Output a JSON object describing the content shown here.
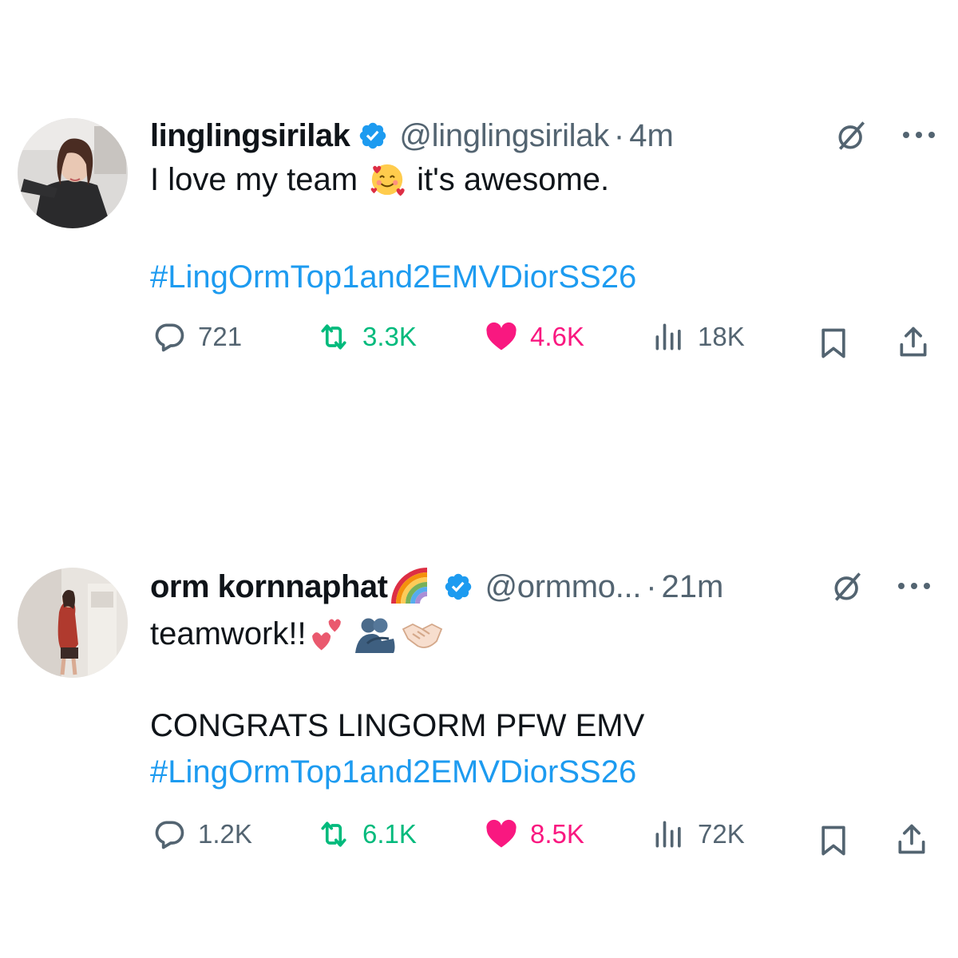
{
  "tweets": [
    {
      "display_name": "linglingsirilak",
      "handle": "@linglingsirilak",
      "separator": "·",
      "time": "4m",
      "text_line1_a": "I love my team",
      "text_line1_b": "it's awesome.",
      "text_line2": "",
      "hashtag": "#LingOrmTop1and2EMVDiorSS26",
      "replies": "721",
      "retweets": "3.3K",
      "likes": "4.6K",
      "views": "18K",
      "emojis": [
        "smiling-face-with-hearts-emoji"
      ]
    },
    {
      "display_name": "orm kornnaphat",
      "handle": "@ormmo...",
      "separator": "·",
      "time": "21m",
      "text_line1_a": "teamwork!!",
      "text_line1_b": "",
      "text_line2": "CONGRATS LINGORM PFW EMV",
      "hashtag": "#LingOrmTop1and2EMVDiorSS26",
      "replies": "1.2K",
      "retweets": "6.1K",
      "likes": "8.5K",
      "views": "72K",
      "emojis": [
        "rainbow-emoji",
        "two-hearts-emoji",
        "people-hugging-emoji",
        "handshake-emoji"
      ]
    }
  ],
  "colors": {
    "text": "#0f1419",
    "secondary": "#536471",
    "link": "#1d9bf0",
    "retweet": "#00ba7c",
    "like": "#f91880",
    "verified": "#1d9bf0"
  }
}
